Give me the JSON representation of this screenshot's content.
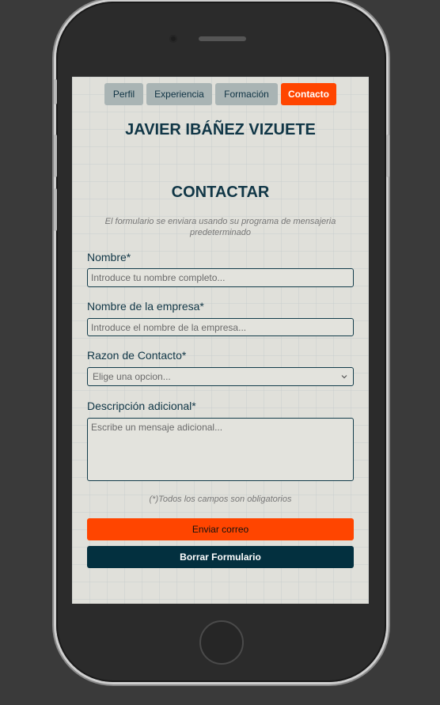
{
  "nav": {
    "tabs": [
      {
        "label": "Perfil",
        "active": false
      },
      {
        "label": "Experiencia",
        "active": false
      },
      {
        "label": "Formación",
        "active": false
      },
      {
        "label": "Contacto",
        "active": true
      }
    ]
  },
  "header": {
    "name": "JAVIER IBÁÑEZ VIZUETE"
  },
  "contact": {
    "title": "CONTACTAR",
    "intro": "El formulario se enviara usando su programa de mensajeria predeterminado",
    "name_label": "Nombre*",
    "name_placeholder": "Introduce tu nombre completo...",
    "company_label": "Nombre de la empresa*",
    "company_placeholder": "Introduce el nombre de la empresa...",
    "reason_label": "Razon de Contacto*",
    "reason_selected": "Elige una opcion...",
    "description_label": "Descripción adicional*",
    "description_placeholder": "Escribe un mensaje adicional...",
    "required_note": "(*)Todos los campos son obligatorios",
    "send_label": "Enviar correo",
    "clear_label": "Borrar Formulario"
  },
  "colors": {
    "accent": "#ff4500",
    "dark": "#03303f",
    "tab_bg": "#a9b4b4",
    "screen_bg": "#e0e0da"
  },
  "icons": {
    "select_arrow": "chevron-down-icon"
  }
}
